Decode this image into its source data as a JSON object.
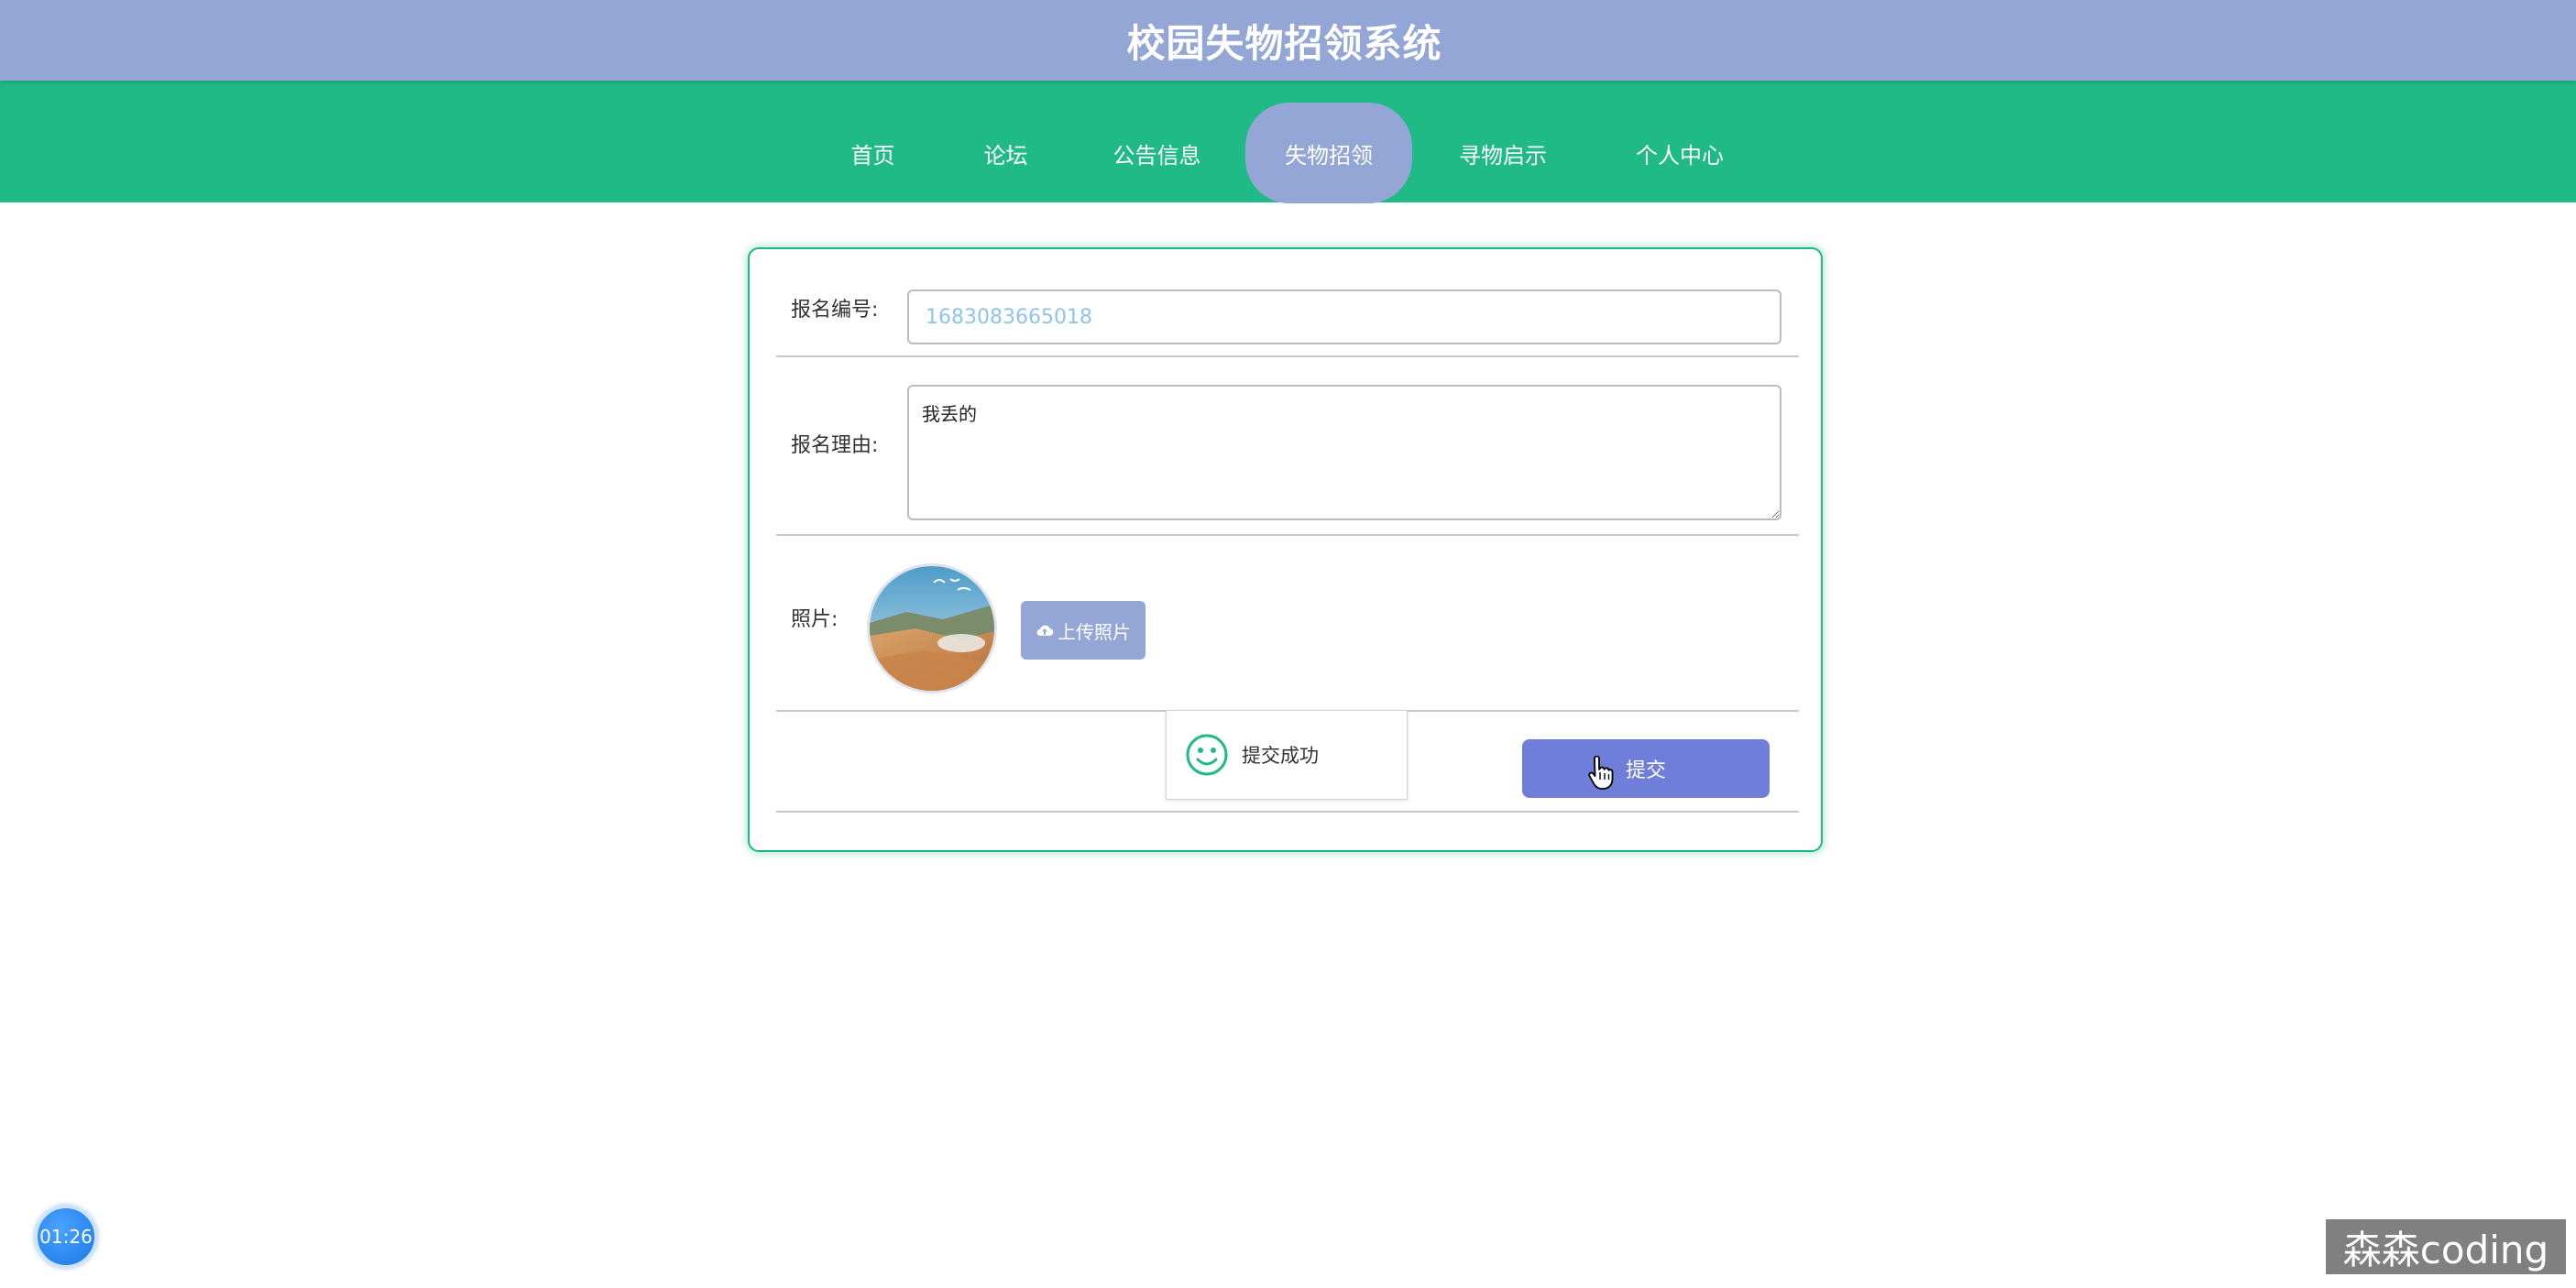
{
  "header": {
    "title": "校园失物招领系统"
  },
  "nav": {
    "items": [
      {
        "label": "首页"
      },
      {
        "label": "论坛"
      },
      {
        "label": "公告信息"
      },
      {
        "label": "失物招领",
        "active": true
      },
      {
        "label": "寻物启示"
      },
      {
        "label": "个人中心"
      }
    ]
  },
  "form": {
    "id_label": "报名编号:",
    "id_value": "1683083665018",
    "reason_label": "报名理由:",
    "reason_value": "我丢的",
    "photo_label": "照片:",
    "upload_label": "上传照片",
    "submit_label": "提交"
  },
  "toast": {
    "text": "提交成功"
  },
  "overlay": {
    "timer": "01:26",
    "watermark": "森森coding"
  },
  "colors": {
    "header": "#93a6d6",
    "nav": "#1fba86",
    "submit": "#6f7fd9",
    "accent": "#1fba86"
  },
  "icons": {
    "upload": "cloud-upload-icon",
    "toast": "smile-icon",
    "cursor": "hand-cursor-icon"
  }
}
